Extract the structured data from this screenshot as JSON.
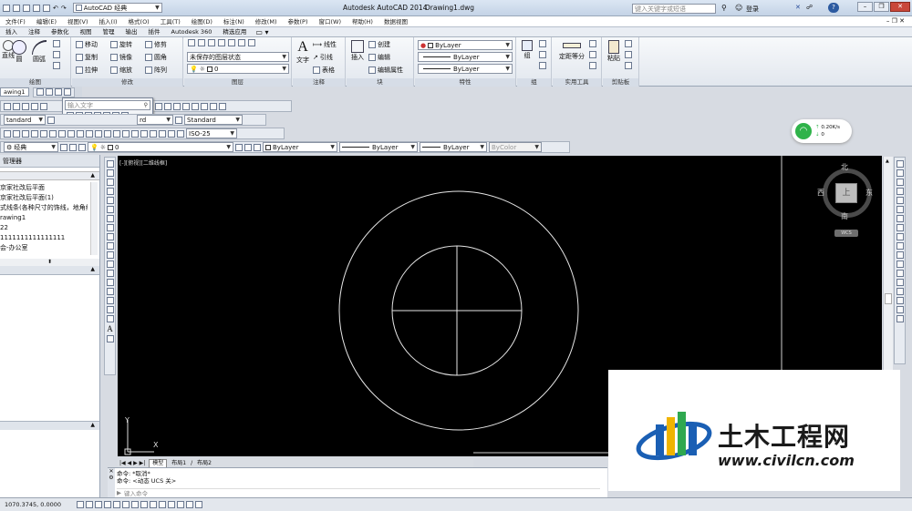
{
  "title_bar": {
    "workspace": "AutoCAD 经典",
    "app_title": "Autodesk AutoCAD 2014",
    "doc_title": "Drawing1.dwg",
    "search_placeholder": "键入关键字或短语",
    "login": "登录",
    "help": "?"
  },
  "menu": [
    "文件(F)",
    "编辑(E)",
    "视图(V)",
    "插入(I)",
    "格式(O)",
    "工具(T)",
    "绘图(D)",
    "标注(N)",
    "修改(M)",
    "参数(P)",
    "窗口(W)",
    "帮助(H)",
    "数据视图"
  ],
  "ribbon_tabs": [
    "插入",
    "注释",
    "参数化",
    "视图",
    "管理",
    "输出",
    "插件",
    "Autodesk 360",
    "精选应用"
  ],
  "ribbon": {
    "draw": {
      "title": "绘图",
      "items": [
        "直线",
        "圆",
        "圆弧"
      ]
    },
    "modify": {
      "title": "修改",
      "items": [
        "移动",
        "旋转",
        "修剪",
        "复制",
        "镜像",
        "圆角",
        "拉伸",
        "缩放",
        "阵列"
      ]
    },
    "layers": {
      "title": "图层",
      "state": "未保存的图层状态",
      "layer": "0"
    },
    "annotation": {
      "title": "注释",
      "items": [
        "文字",
        "线性",
        "引线",
        "表格"
      ]
    },
    "block": {
      "title": "块",
      "items": [
        "插入",
        "创建",
        "编辑",
        "编辑属性"
      ]
    },
    "properties": {
      "title": "特性",
      "color": "ByLayer",
      "linetype": "ByLayer",
      "lineweight": "ByLayer"
    },
    "groups": {
      "title": "组",
      "items": [
        "组"
      ]
    },
    "utilities": {
      "title": "实用工具",
      "items": [
        "定距等分"
      ]
    },
    "clipboard": {
      "title": "剪贴板",
      "items": [
        "粘贴"
      ]
    }
  },
  "toolbars": {
    "search_input_placeholder": "输入文字",
    "text_style": "Standard",
    "dim_style_left": "rd",
    "table_style": "Standard",
    "dim_style": "ISO-25",
    "workspace_combo": "经典",
    "layer_combo": "0",
    "color": "ByLayer",
    "linetype": "ByLayer",
    "lineweight": "ByLayer",
    "plotstyle": "ByColor",
    "doc_tab": "awing1"
  },
  "net_widget": {
    "upload": "0.20K/s",
    "download": "0"
  },
  "left_panel": {
    "title": "管理器",
    "items": [
      "京家社改后平面",
      "京家社改后平面(1)",
      "式线条(各种尺寸的饰线，地角线，",
      "rawing1",
      "22",
      "1111111111111111",
      "会-办公室"
    ],
    "standard_combo": "tandard"
  },
  "viewport": {
    "label": "[-][俯视][二维线框]",
    "compass": {
      "north": "北",
      "south": "南",
      "west": "西",
      "east": "东",
      "center": "上",
      "ucs": "WCS"
    },
    "ucs_y": "Y",
    "ucs_x": "X"
  },
  "layout_tabs": [
    "模型",
    "布局1",
    "布局2"
  ],
  "command": {
    "history": [
      "命令: *取消*",
      "命令: <动态 UCS 关>"
    ],
    "placeholder": "键入命令"
  },
  "status": {
    "coords": "1070.3745, 0.0000"
  },
  "watermark": {
    "text": "土木工程网",
    "url": "www.civilcn.com"
  }
}
